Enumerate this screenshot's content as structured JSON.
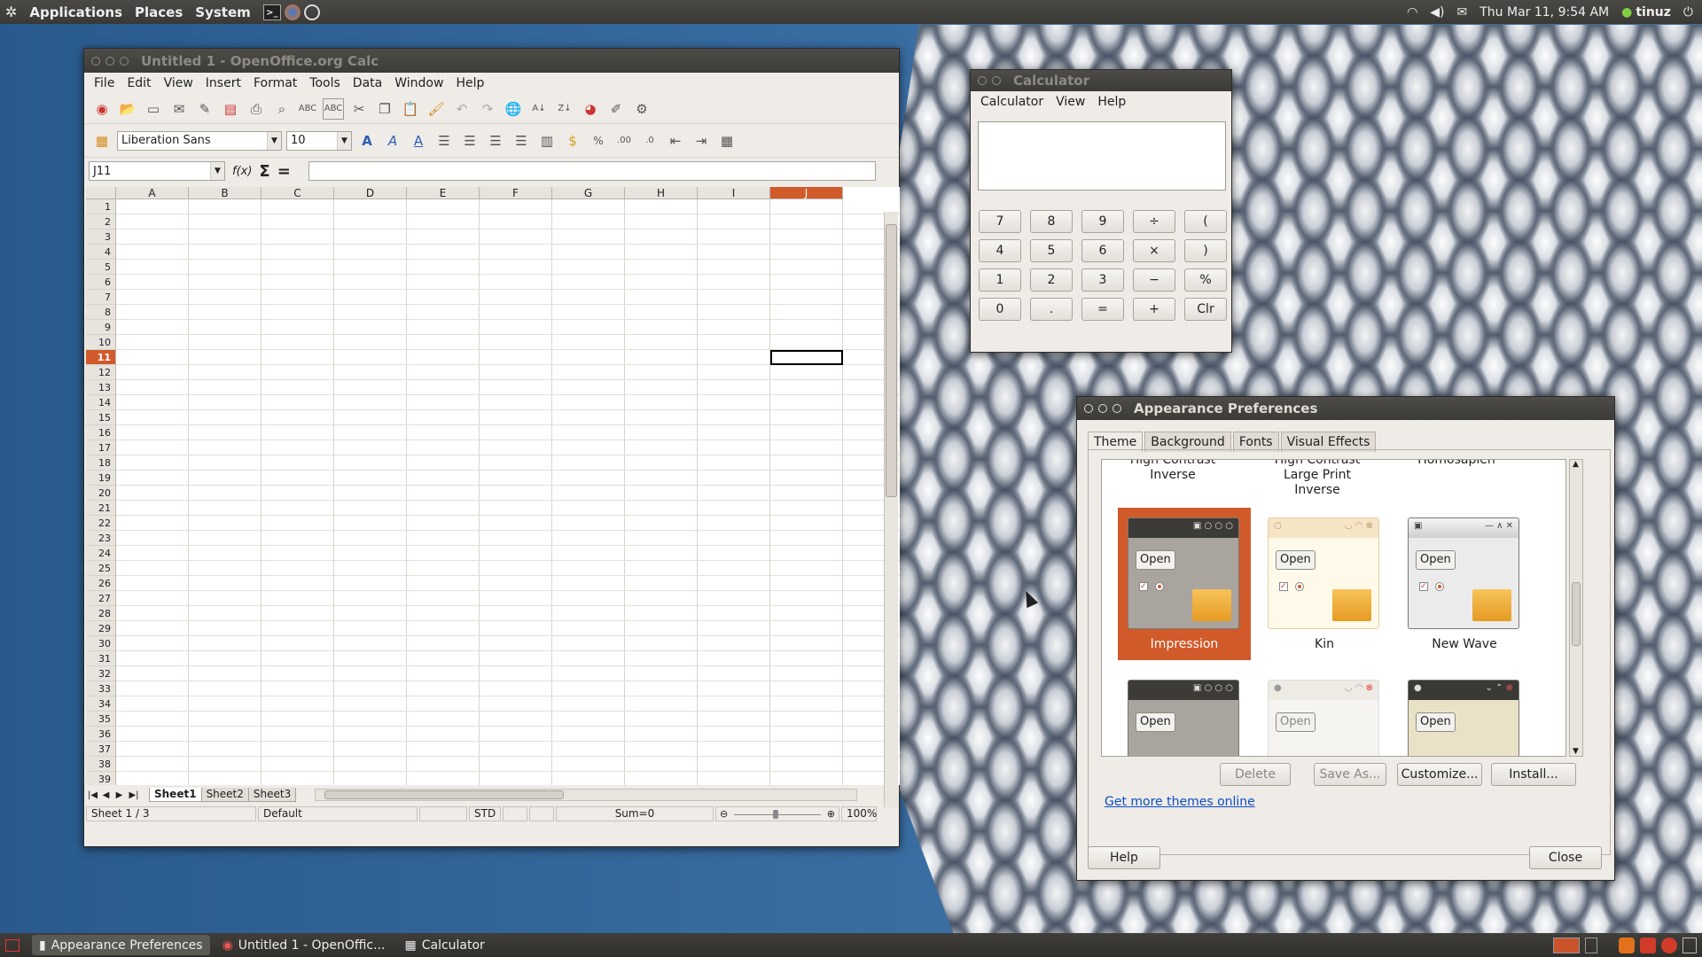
{
  "top_panel": {
    "menus": [
      "Applications",
      "Places",
      "System"
    ],
    "clock": "Thu Mar 11,  9:54 AM",
    "user": "tinuz"
  },
  "calc_window": {
    "title": "Untitled 1 - OpenOffice.org Calc",
    "menus": [
      "File",
      "Edit",
      "View",
      "Insert",
      "Format",
      "Tools",
      "Data",
      "Window",
      "Help"
    ],
    "font_name": "Liberation Sans",
    "font_size": "10",
    "cell_ref": "J11",
    "formula_fx": "f(x)",
    "formula_sum": "Σ",
    "formula_eq": "=",
    "columns": [
      "A",
      "B",
      "C",
      "D",
      "E",
      "F",
      "G",
      "H",
      "I",
      "J"
    ],
    "active_column": "J",
    "active_row": "11",
    "rows": [
      "1",
      "2",
      "3",
      "4",
      "5",
      "6",
      "7",
      "8",
      "9",
      "10",
      "11",
      "12",
      "13",
      "14",
      "15",
      "16",
      "17",
      "18",
      "19",
      "20",
      "21",
      "22",
      "23",
      "24",
      "25",
      "26",
      "27",
      "28",
      "29",
      "30",
      "31",
      "32",
      "33",
      "34",
      "35",
      "36",
      "37",
      "38",
      "39"
    ],
    "sheets": [
      "Sheet1",
      "Sheet2",
      "Sheet3"
    ],
    "active_sheet": "Sheet1",
    "status": {
      "sheet": "Sheet 1 / 3",
      "style": "Default",
      "mode": "STD",
      "sum": "Sum=0",
      "zoom": "100%"
    }
  },
  "calculator": {
    "title": "Calculator",
    "menus": [
      "Calculator",
      "View",
      "Help"
    ],
    "keys": [
      "7",
      "8",
      "9",
      "÷",
      "(",
      "4",
      "5",
      "6",
      "×",
      ")",
      "1",
      "2",
      "3",
      "−",
      "%",
      "0",
      ".",
      "=",
      "+",
      "Clr"
    ]
  },
  "appearance": {
    "title": "Appearance Preferences",
    "tabs": [
      "Theme",
      "Background",
      "Fonts",
      "Visual Effects"
    ],
    "active_tab": "Theme",
    "partial_labels": [
      "High Contrast Inverse",
      "High Contrast Large Print Inverse",
      "Homosapien"
    ],
    "themes": [
      {
        "name": "Impression",
        "selected": true
      },
      {
        "name": "Kin",
        "selected": false
      },
      {
        "name": "New Wave",
        "selected": false
      }
    ],
    "open_label": "Open",
    "buttons": {
      "delete": "Delete",
      "save_as": "Save As...",
      "customize": "Customize...",
      "install": "Install..."
    },
    "more_link": "Get more themes online",
    "help": "Help",
    "close": "Close"
  },
  "taskbar": {
    "items": [
      "Appearance Preferences",
      "Untitled 1 - OpenOffic...",
      "Calculator"
    ]
  },
  "colors": {
    "selection": "#d15a2a",
    "panel": "#3c3b37",
    "link": "#0b4fc2"
  }
}
